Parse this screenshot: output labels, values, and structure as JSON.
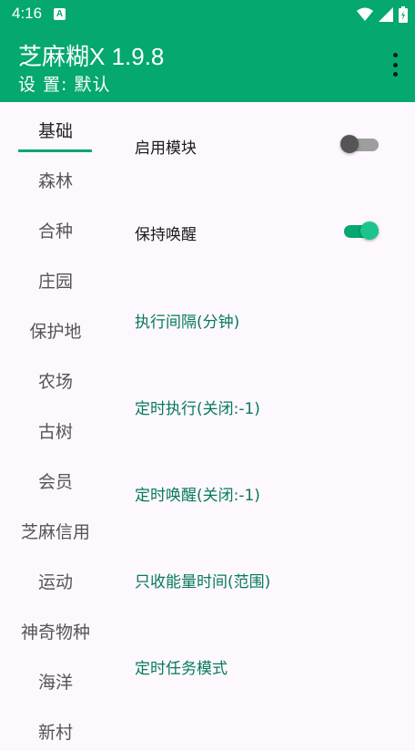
{
  "status_bar": {
    "time": "4:16",
    "notification": "A"
  },
  "app_bar": {
    "title": "芝麻糊X 1.9.8",
    "subtitle": "设 置: 默认"
  },
  "tabs": [
    "基础",
    "森林",
    "合种",
    "庄园",
    "保护地",
    "农场",
    "古树",
    "会员",
    "芝麻信用",
    "运动",
    "神奇物种",
    "海洋",
    "新村"
  ],
  "active_tab": "基础",
  "settings": {
    "enable_module": {
      "label": "启用模块",
      "checked": false
    },
    "keep_awake": {
      "label": "保持唤醒",
      "checked": true
    },
    "exec_interval": "执行间隔(分钟)",
    "timed_exec": "定时执行(关闭:-1)",
    "timed_wake": "定时唤醒(关闭:-1)",
    "energy_time": "只收能量时间(范围)",
    "task_mode": "定时任务模式"
  },
  "colors": {
    "primary": "#05a86f",
    "link": "#067a5b",
    "background": "#fdf8fd"
  }
}
